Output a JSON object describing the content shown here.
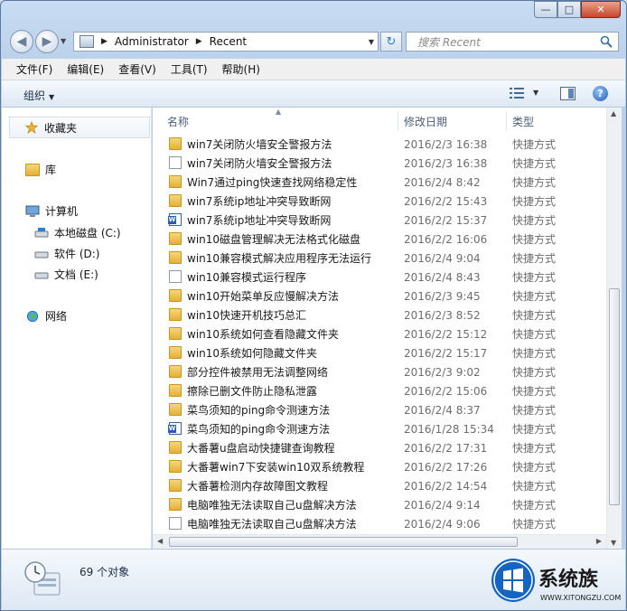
{
  "address": {
    "crumbs": [
      "Administrator",
      "Recent"
    ],
    "search_placeholder": "搜索 Recent"
  },
  "menu": [
    "文件(F)",
    "编辑(E)",
    "查看(V)",
    "工具(T)",
    "帮助(H)"
  ],
  "commandbar": {
    "organize_label": "组织"
  },
  "navpane": {
    "favorites": "收藏夹",
    "libraries": "库",
    "computer": "计算机",
    "drives": [
      "本地磁盘 (C:)",
      "软件 (D:)",
      "文档 (E:)"
    ],
    "network": "网络"
  },
  "columns": {
    "name": "名称",
    "date": "修改日期",
    "type": "类型"
  },
  "files": [
    {
      "icon": "folder",
      "name": "win7关闭防火墙安全警报方法",
      "date": "2016/2/3 16:38",
      "type": "快捷方式"
    },
    {
      "icon": "file",
      "name": "win7关闭防火墙安全警报方法",
      "date": "2016/2/3 16:38",
      "type": "快捷方式"
    },
    {
      "icon": "folder",
      "name": "Win7通过ping快速查找网络稳定性",
      "date": "2016/2/4 8:42",
      "type": "快捷方式"
    },
    {
      "icon": "folder",
      "name": "win7系统ip地址冲突导致断网",
      "date": "2016/2/2 15:43",
      "type": "快捷方式"
    },
    {
      "icon": "doc",
      "name": "win7系统ip地址冲突导致断网",
      "date": "2016/2/2 15:37",
      "type": "快捷方式"
    },
    {
      "icon": "folder",
      "name": "win10磁盘管理解决无法格式化磁盘",
      "date": "2016/2/2 16:06",
      "type": "快捷方式"
    },
    {
      "icon": "folder",
      "name": "win10兼容模式解决应用程序无法运行",
      "date": "2016/2/4 9:04",
      "type": "快捷方式"
    },
    {
      "icon": "file",
      "name": "win10兼容模式运行程序",
      "date": "2016/2/4 8:43",
      "type": "快捷方式"
    },
    {
      "icon": "folder",
      "name": "win10开始菜单反应慢解决方法",
      "date": "2016/2/3 9:45",
      "type": "快捷方式"
    },
    {
      "icon": "folder",
      "name": "win10快速开机技巧总汇",
      "date": "2016/2/3 8:52",
      "type": "快捷方式"
    },
    {
      "icon": "folder",
      "name": "win10系统如何查看隐藏文件夹",
      "date": "2016/2/2 15:12",
      "type": "快捷方式"
    },
    {
      "icon": "folder",
      "name": "win10系统如何隐藏文件夹",
      "date": "2016/2/2 15:17",
      "type": "快捷方式"
    },
    {
      "icon": "folder",
      "name": "部分控件被禁用无法调整网络",
      "date": "2016/2/3 9:02",
      "type": "快捷方式"
    },
    {
      "icon": "folder",
      "name": "擦除已删文件防止隐私泄露",
      "date": "2016/2/2 15:06",
      "type": "快捷方式"
    },
    {
      "icon": "folder",
      "name": "菜鸟须知的ping命令测速方法",
      "date": "2016/2/4 8:37",
      "type": "快捷方式"
    },
    {
      "icon": "doc",
      "name": "菜鸟须知的ping命令测速方法",
      "date": "2016/1/28 15:34",
      "type": "快捷方式"
    },
    {
      "icon": "folder",
      "name": "大番薯u盘启动快捷键查询教程",
      "date": "2016/2/2 17:31",
      "type": "快捷方式"
    },
    {
      "icon": "folder",
      "name": "大番薯win7下安装win10双系统教程",
      "date": "2016/2/2 17:26",
      "type": "快捷方式"
    },
    {
      "icon": "folder",
      "name": "大番薯检测内存故障图文教程",
      "date": "2016/2/2 14:54",
      "type": "快捷方式"
    },
    {
      "icon": "folder",
      "name": "电脑唯独无法读取自己u盘解决方法",
      "date": "2016/2/4 9:14",
      "type": "快捷方式"
    },
    {
      "icon": "file",
      "name": "电脑唯独无法读取自己u盘解决方法",
      "date": "2016/2/4 9:06",
      "type": "快捷方式"
    }
  ],
  "status": {
    "count": "69 个对象"
  },
  "watermark": {
    "brand": "系统族",
    "url": "WWW.XITONGZU.COM"
  }
}
